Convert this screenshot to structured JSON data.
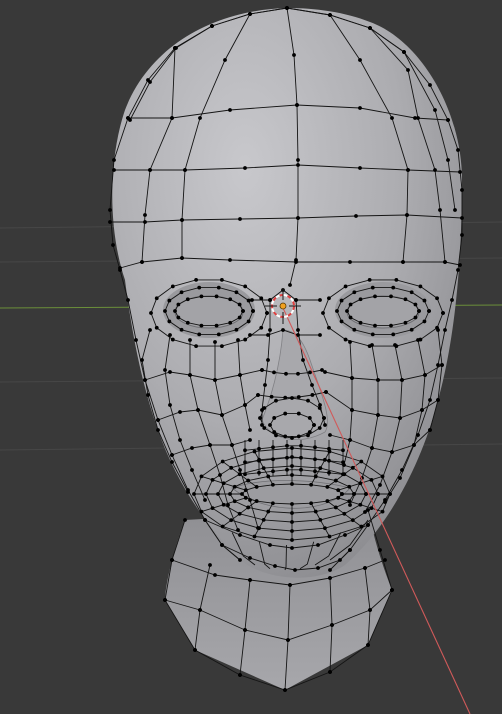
{
  "viewport": {
    "name": "3D Viewport",
    "background_color": "#393939",
    "grid_line_color": "#474747",
    "x_axis_color": "#6b8f3a",
    "y_axis_color": "#d05a5a"
  },
  "mesh": {
    "name": "head-mesh",
    "surface_color": "#b4b4b8",
    "wire_color": "#141414",
    "vertex_color": "#000000"
  },
  "cursor": {
    "name": "3d-cursor",
    "ring_color_a": "#e04040",
    "ring_color_b": "#ffffff",
    "origin_color": "#f0a020"
  }
}
